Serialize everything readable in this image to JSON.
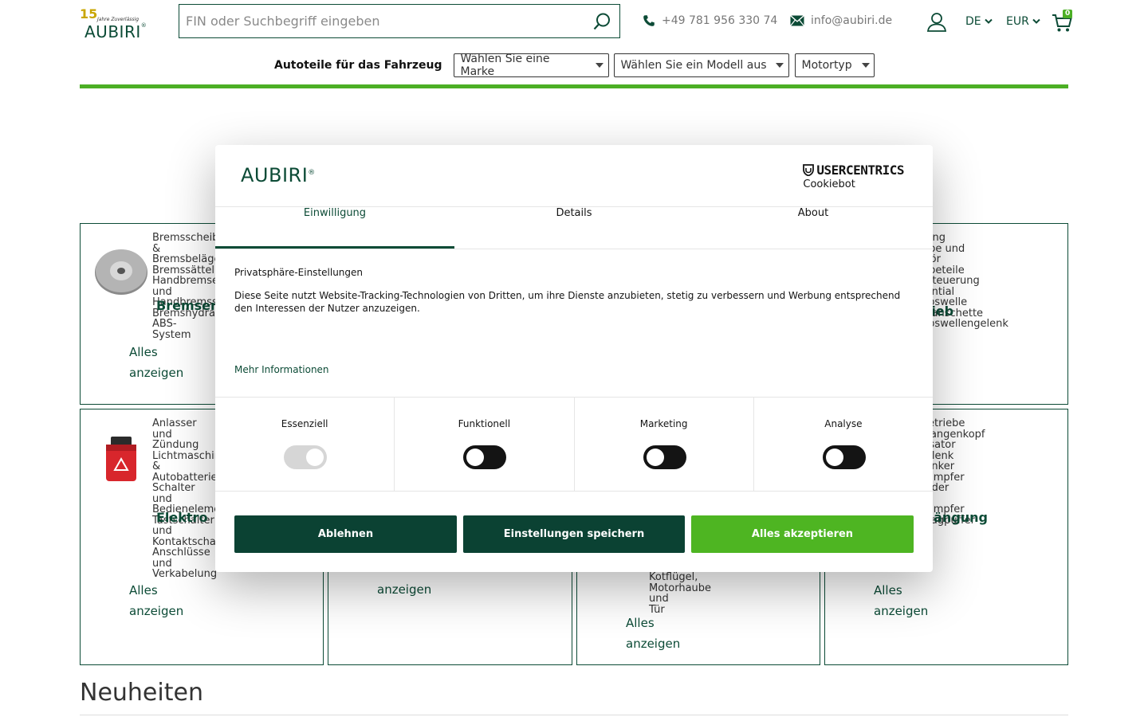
{
  "header": {
    "logo_badge": "15",
    "logo_tag": "Jahre Zuverlässig",
    "logo_word": "AUBIRI",
    "search_placeholder": "FIN oder Suchbegriff eingeben",
    "phone": "+49 781 956 330 74",
    "email": "info@aubiri.de",
    "language": "DE",
    "currency": "EUR",
    "cart_count": "0"
  },
  "vehicle": {
    "label": "Autoteile für das Fahrzeug",
    "brand_select": "Wählen Sie eine Marke",
    "model_select": "Wählen Sie ein Modell aus",
    "engine_select": "Motortyp"
  },
  "categories": {
    "brakes": {
      "title": "Bremsen",
      "links": [
        "Bremsscheiben",
        "&",
        "Bremsbeläge",
        "Bremssättel",
        "Handbremse",
        "und",
        "Handbremsseil",
        "Bremshydraulik",
        "ABS-",
        "System"
      ],
      "all": [
        "Alles",
        "anzeigen"
      ]
    },
    "drive": {
      "title": "Antrieb",
      "links": [
        "Kupplung",
        "",
        "Getriebe und",
        "Zubehör",
        "Getriebeteile",
        "Motorsteuerung",
        "Differential",
        "Antriebswelle",
        "Achsmanschette",
        "",
        "Antriebswellengelenk"
      ]
    },
    "electrics": {
      "title": "Elektro",
      "links": [
        "Anlasser",
        "und",
        "Zündung",
        "Lichtmaschine",
        "&",
        "Autobatterie",
        "Schalter",
        "und",
        "Bedienelemente",
        "Tastschalter",
        "und",
        "Kontaktschalter",
        "Anschlüsse",
        "und",
        "Verkabelung"
      ],
      "all": [
        "Alles",
        "anzeigen"
      ]
    },
    "col2_bottom": {
      "all": [
        "Alles",
        "anzeigen"
      ]
    },
    "col3_bottom": {
      "links": [
        "Kotflügel,",
        "Motorhaube",
        "und",
        "Tür"
      ],
      "all": [
        "Alles",
        "anzeigen"
      ]
    },
    "suspension": {
      "title": "Aufhängung",
      "links": [
        "Lenkgetriebe",
        "",
        "Spurstangenkopf",
        "Stabilisator",
        "",
        "Traggelenk",
        "",
        "Querlenker",
        "Stoßdämpfer",
        "und Feder",
        "Federn",
        "",
        "Stoßdämpfer",
        "",
        "Anschlagpuffer"
      ],
      "all": [
        "Alles",
        "anzeigen"
      ]
    }
  },
  "section_title": "Neuheiten",
  "consent": {
    "logo_word": "AUBIRI",
    "uc_brand": "USERCENTRICS",
    "uc_product": "Cookiebot",
    "tabs": [
      "Einwilligung",
      "Details",
      "About"
    ],
    "heading": "Privatsphäre-Einstellungen",
    "text": "Diese Seite nutzt Website-Tracking-Technologien von Dritten, um ihre Dienste anzubieten, stetig zu verbessern und Werbung entsprechend den Interessen der Nutzer anzuzeigen.",
    "more": "Mehr Informationen",
    "categories": [
      "Essenziell",
      "Funktionell",
      "Marketing",
      "Analyse"
    ],
    "buttons": {
      "deny": "Ablehnen",
      "save": "Einstellungen speichern",
      "accept": "Alles akzeptieren"
    },
    "colors": {
      "dark_green": "#0b4233",
      "accent_green": "#4eb522"
    }
  }
}
